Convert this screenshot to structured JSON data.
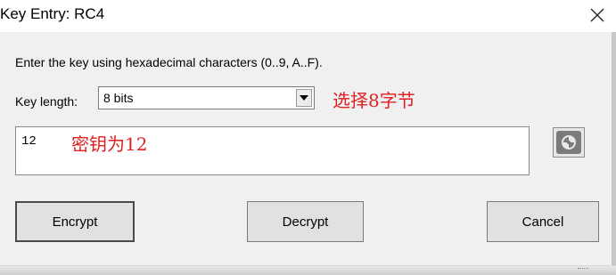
{
  "window": {
    "title": "Key Entry: RC4",
    "close_icon": "close-icon"
  },
  "form": {
    "instructions": "Enter the key using hexadecimal characters (0..9, A..F).",
    "key_length_label": "Key length:",
    "key_length_value": "8 bits",
    "key_value": "12"
  },
  "annotations": {
    "select_note": "选择8字节",
    "key_note": "密钥为12",
    "color": "#e02020"
  },
  "buttons": {
    "encrypt": "Encrypt",
    "decrypt": "Decrypt",
    "cancel": "Cancel"
  },
  "icons": {
    "dropdown": "chevron-down-icon",
    "side_tool": "wheel-icon"
  }
}
